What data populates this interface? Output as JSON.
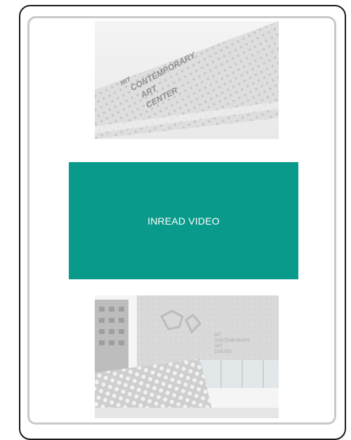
{
  "top_image": {
    "alt_icon": "building-facade-photo",
    "sign_lines": [
      "MIT",
      "CONTEMPORARY",
      "ART",
      "CENTER"
    ]
  },
  "ad": {
    "label": "INREAD VIDEO",
    "color": "#0a9a8b"
  },
  "bottom_image": {
    "alt_icon": "building-exterior-photo",
    "sign_lines": [
      "MIT",
      "CONTEMPORARY",
      "ART",
      "CENTER"
    ]
  }
}
